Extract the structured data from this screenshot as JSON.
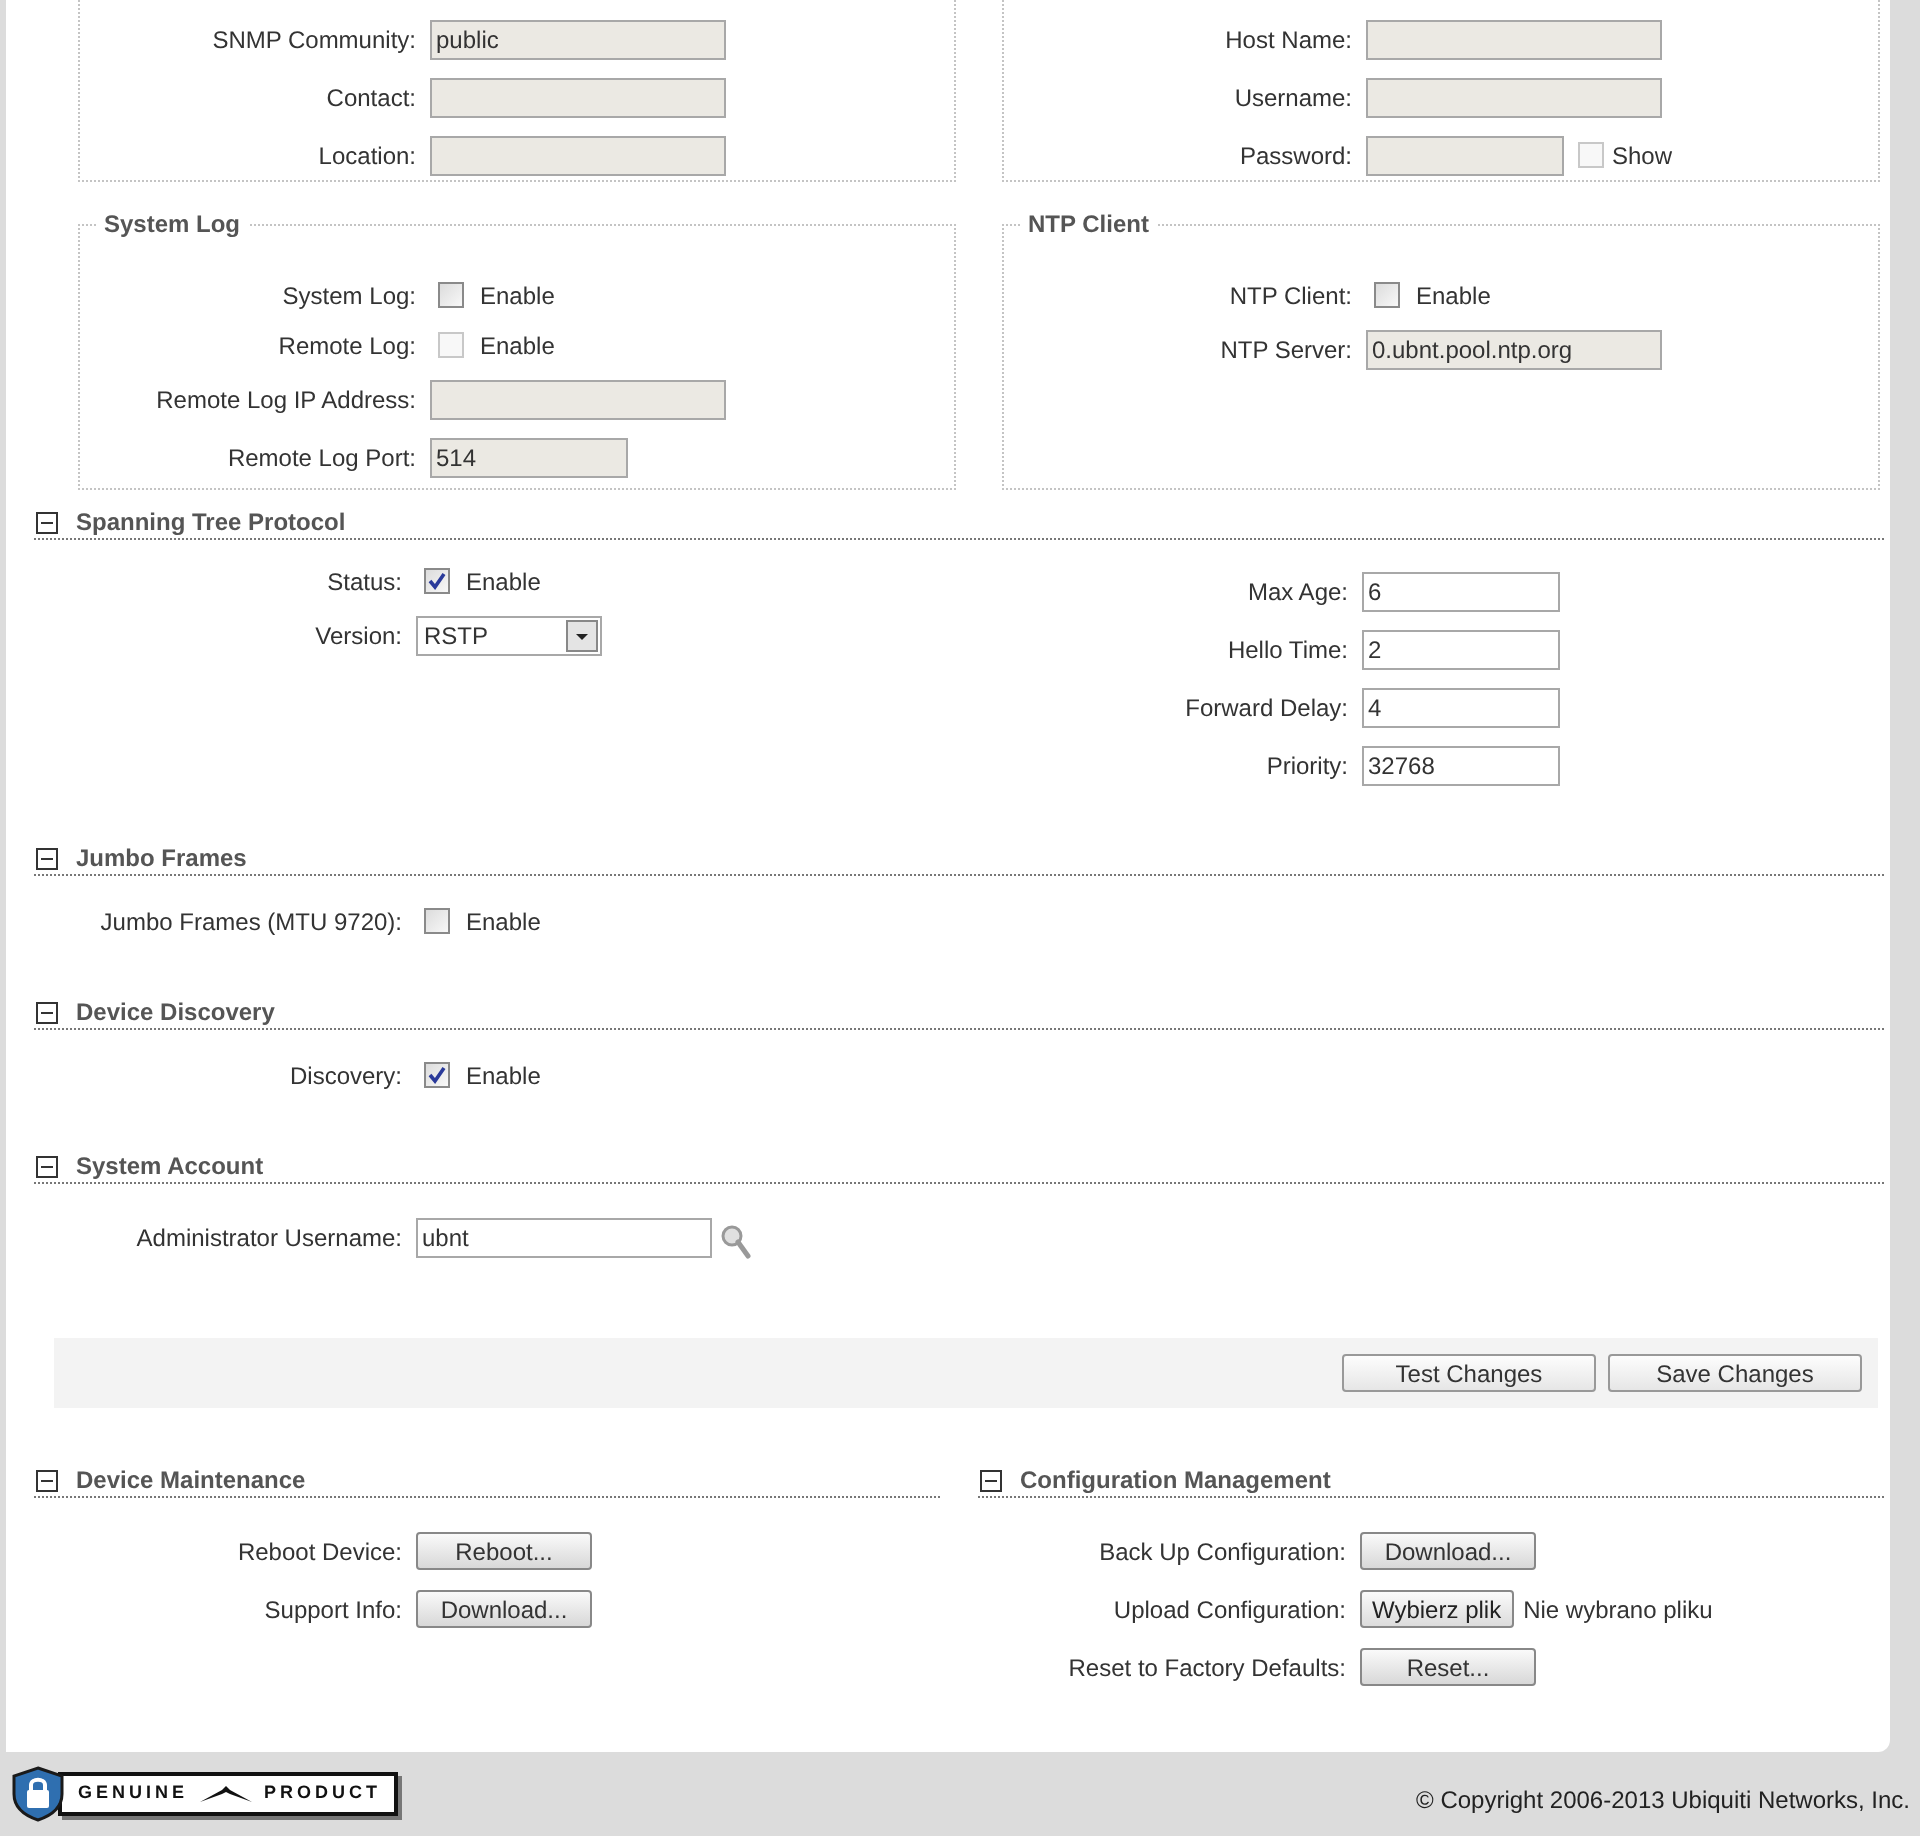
{
  "fieldset_rows": [
    [
      {
        "rows": [
          {
            "kind": "text",
            "label": "SNMP Community:",
            "value": "public",
            "disabled": true
          },
          {
            "kind": "text",
            "label": "Contact:",
            "disabled": true
          },
          {
            "kind": "text",
            "label": "Location:",
            "disabled": true
          }
        ]
      },
      {
        "rows": [
          {
            "kind": "text",
            "label": "Host Name:",
            "disabled": true
          },
          {
            "kind": "text",
            "label": "Username:",
            "disabled": true
          },
          {
            "kind": "password",
            "label": "Password:",
            "disabled": true,
            "show_label": "Show",
            "show_checked": false
          }
        ]
      }
    ],
    [
      {
        "legend": "System Log",
        "rows": [
          {
            "kind": "checkbox",
            "label": "System Log:",
            "option": "Enable",
            "checked": false,
            "disabled": false
          },
          {
            "kind": "checkbox",
            "label": "Remote Log:",
            "option": "Enable",
            "checked": false,
            "disabled": true
          },
          {
            "kind": "text",
            "label": "Remote Log IP Address:",
            "disabled": true
          },
          {
            "kind": "short_text",
            "label": "Remote Log Port:",
            "value": "514",
            "disabled": true
          }
        ]
      },
      {
        "legend": "NTP Client",
        "rows": [
          {
            "kind": "checkbox",
            "label": "NTP Client:",
            "option": "Enable",
            "checked": false,
            "disabled": false
          },
          {
            "kind": "text",
            "label": "NTP Server:",
            "value": "0.ubnt.pool.ntp.org",
            "disabled": true
          }
        ]
      }
    ]
  ],
  "sections": [
    {
      "title": "Spanning Tree Protocol",
      "expanded": true,
      "columns": [
        [
          {
            "kind": "checkbox",
            "label": "Status:",
            "option": "Enable",
            "checked": true,
            "disabled": false
          },
          {
            "kind": "select",
            "label": "Version:",
            "value": "RSTP"
          }
        ],
        [
          {
            "kind": "short_text",
            "label": "Max Age:",
            "value": "6",
            "disabled": false
          },
          {
            "kind": "short_text",
            "label": "Hello Time:",
            "value": "2",
            "disabled": false
          },
          {
            "kind": "short_text",
            "label": "Forward Delay:",
            "value": "4",
            "disabled": false
          },
          {
            "kind": "short_text",
            "label": "Priority:",
            "value": "32768",
            "disabled": false
          }
        ]
      ]
    },
    {
      "title": "Jumbo Frames",
      "expanded": true,
      "columns": [
        [
          {
            "kind": "checkbox",
            "label": "Jumbo Frames (MTU 9720):",
            "option": "Enable",
            "checked": false,
            "disabled": false
          }
        ]
      ]
    },
    {
      "title": "Device Discovery",
      "expanded": true,
      "columns": [
        [
          {
            "kind": "checkbox",
            "label": "Discovery:",
            "option": "Enable",
            "checked": true,
            "disabled": false
          }
        ]
      ]
    },
    {
      "title": "System Account",
      "expanded": true,
      "columns": [
        [
          {
            "kind": "lookup",
            "label": "Administrator Username:",
            "value": "ubnt",
            "disabled": false
          }
        ]
      ]
    }
  ],
  "actions": [
    "Test Changes",
    "Save Changes"
  ],
  "bottom_sections": [
    {
      "title": "Device Maintenance",
      "expanded": true,
      "rows": [
        {
          "kind": "button",
          "label": "Reboot Device:",
          "button": "Reboot..."
        },
        {
          "kind": "button",
          "label": "Support Info:",
          "button": "Download..."
        }
      ]
    },
    {
      "title": "Configuration Management",
      "expanded": true,
      "rows": [
        {
          "kind": "button",
          "label": "Back Up Configuration:",
          "button": "Download..."
        },
        {
          "kind": "file",
          "label": "Upload Configuration:",
          "button": "Wybierz plik",
          "status": "Nie wybrano pliku"
        },
        {
          "kind": "button",
          "label": "Reset to Factory Defaults:",
          "button": "Reset..."
        }
      ]
    }
  ],
  "footer": {
    "badge": [
      "GENUINE",
      "PRODUCT"
    ],
    "copyright": "© Copyright 2006-2013 Ubiquiti Networks, Inc."
  }
}
